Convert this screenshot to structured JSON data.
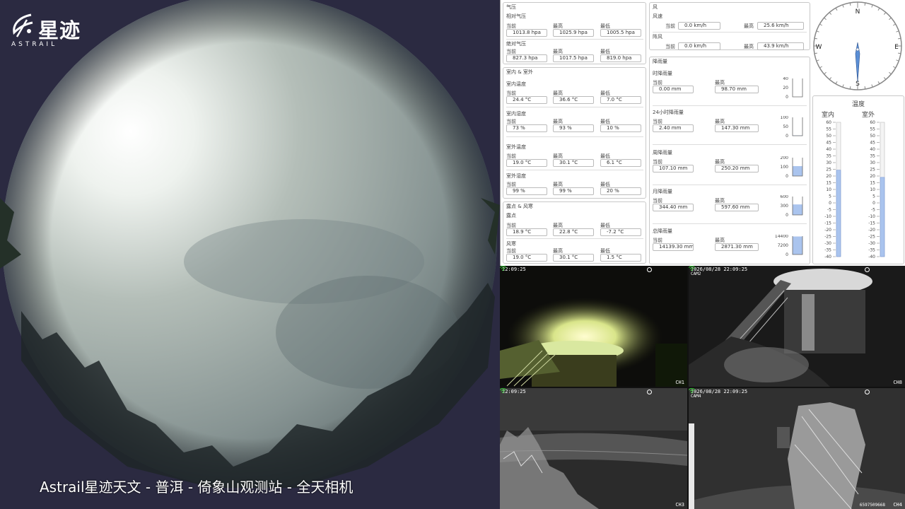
{
  "brand": {
    "cn": "星迹",
    "en": "ASTRAIL"
  },
  "sky_caption": "Astrail星迹天文 - 普洱 - 倚象山观测站 - 全天相机",
  "pressure": {
    "title": "气压",
    "relative": {
      "label": "相对气压",
      "cur_label": "当前",
      "max_label": "最高",
      "min_label": "最低",
      "cur": "1013.8 hpa",
      "max": "1025.9 hpa",
      "min": "1005.5 hpa"
    },
    "absolute": {
      "label": "绝对气压",
      "cur_label": "当前",
      "max_label": "最高",
      "min_label": "最低",
      "cur": "827.3 hpa",
      "max": "1017.5 hpa",
      "min": "819.0 hpa"
    }
  },
  "indoor": {
    "title": "室内 & 室外",
    "in_temp": {
      "label": "室内温度",
      "cur_label": "当前",
      "max_label": "最高",
      "min_label": "最低",
      "cur": "24.4 °C",
      "max": "36.6 °C",
      "min": "7.0 °C"
    },
    "in_hum": {
      "label": "室内湿度",
      "cur_label": "当前",
      "max_label": "最高",
      "min_label": "最低",
      "cur": "73 %",
      "max": "93 %",
      "min": "10 %"
    },
    "out_temp": {
      "label": "室外温度",
      "cur_label": "当前",
      "max_label": "最高",
      "min_label": "最低",
      "cur": "19.0 °C",
      "max": "30.1 °C",
      "min": "6.1 °C"
    },
    "out_hum": {
      "label": "室外湿度",
      "cur_label": "当前",
      "max_label": "最高",
      "min_label": "最低",
      "cur": "99 %",
      "max": "99 %",
      "min": "20 %"
    }
  },
  "dew": {
    "title": "露点 & 风寒",
    "dew": {
      "label": "露点",
      "cur_label": "当前",
      "max_label": "最高",
      "min_label": "最低",
      "cur": "18.9 °C",
      "max": "22.8 °C",
      "min": "-7.2 °C"
    },
    "chill": {
      "label": "风寒",
      "cur_label": "当前",
      "max_label": "最高",
      "min_label": "最低",
      "cur": "19.0 °C",
      "max": "30.1 °C",
      "min": "1.5 °C"
    }
  },
  "wind": {
    "title": "风",
    "speed": {
      "label": "风速",
      "cur_label": "当前",
      "max_label": "最高",
      "cur": "0.0 km/h",
      "max": "25.6 km/h"
    },
    "gust": {
      "label": "阵风",
      "cur_label": "当前",
      "max_label": "最高",
      "cur": "0.0 km/h",
      "max": "43.9 km/h"
    }
  },
  "rain": {
    "title": "降雨量",
    "items": [
      {
        "label": "时降雨量",
        "cur_label": "当前",
        "max_label": "最高",
        "cur": "0.00 mm",
        "max": "98.70 mm",
        "ticks": [
          "40",
          "20",
          "0"
        ],
        "fill": 0.0
      },
      {
        "label": "24小时降雨量",
        "cur_label": "当前",
        "max_label": "最高",
        "cur": "2.40 mm",
        "max": "147.30 mm",
        "ticks": [
          "100",
          "50",
          "0"
        ],
        "fill": 0.02
      },
      {
        "label": "周降雨量",
        "cur_label": "当前",
        "max_label": "最高",
        "cur": "107.10 mm",
        "max": "250.20 mm",
        "ticks": [
          "200",
          "100",
          "0"
        ],
        "fill": 0.54
      },
      {
        "label": "月降雨量",
        "cur_label": "当前",
        "max_label": "最高",
        "cur": "344.40 mm",
        "max": "597.60 mm",
        "ticks": [
          "600",
          "300",
          "0"
        ],
        "fill": 0.57
      },
      {
        "label": "总降雨量",
        "cur_label": "当前",
        "max_label": "最高",
        "cur": "14139.30 mm",
        "max": "2871.30 mm",
        "ticks": [
          "14400",
          "7200",
          "0"
        ],
        "fill": 0.98
      }
    ]
  },
  "compass": {
    "n": "N",
    "s": "S",
    "e": "E",
    "w": "W"
  },
  "thermo": {
    "title": "温度",
    "indoor_label": "室内",
    "outdoor_label": "室外",
    "scale": [
      "60",
      "55",
      "50",
      "45",
      "40",
      "35",
      "30",
      "25",
      "20",
      "15",
      "10",
      "5",
      "0",
      "-5",
      "-10",
      "-15",
      "-20",
      "-25",
      "-30",
      "-35",
      "-40"
    ],
    "indoor_value": 24.4,
    "outdoor_value": 19.0,
    "min": -40,
    "max": 60
  },
  "cams": [
    {
      "ts": "22:09:25",
      "ts2": "",
      "ch": "CH1",
      "id": ""
    },
    {
      "ts": "2026/08/28 22:09:25",
      "ts2": "CAM2",
      "ch": "CH8",
      "id": ""
    },
    {
      "ts": "22:09:25",
      "ts2": "",
      "ch": "CH3",
      "id": ""
    },
    {
      "ts": "2026/08/28 22:09:25",
      "ts2": "CAM4",
      "ch": "CH4",
      "id": "6597509668"
    }
  ],
  "colors": {
    "bar": "#aac4ee",
    "bar_edge": "#6f8fd0",
    "panel_border": "#c8c8c8"
  }
}
